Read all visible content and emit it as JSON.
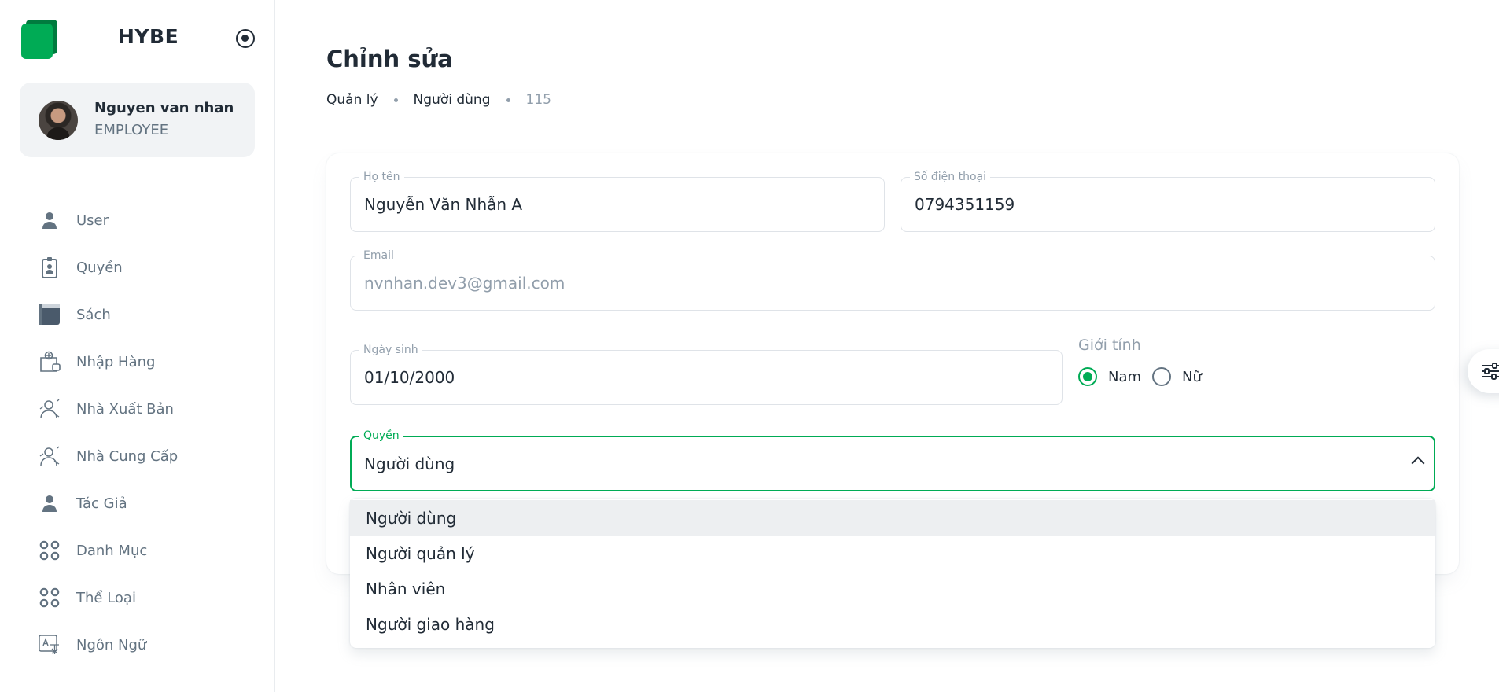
{
  "brand": {
    "name": "HYBE"
  },
  "account": {
    "name": "Nguyen van nhan",
    "role": "EMPLOYEE"
  },
  "sidebar": {
    "items": [
      {
        "label": "User",
        "icon": "person-icon"
      },
      {
        "label": "Quyền",
        "icon": "id-badge-icon"
      },
      {
        "label": "Sách",
        "icon": "book-icon"
      },
      {
        "label": "Nhập Hàng",
        "icon": "import-bag-icon"
      },
      {
        "label": "Nhà Xuất Bản",
        "icon": "publisher-icon"
      },
      {
        "label": "Nhà Cung Cấp",
        "icon": "supplier-icon"
      },
      {
        "label": "Tác Giả",
        "icon": "person-icon"
      },
      {
        "label": "Danh Mục",
        "icon": "grid-circles-icon"
      },
      {
        "label": "Thể Loại",
        "icon": "grid-circles-icon"
      },
      {
        "label": "Ngôn Ngữ",
        "icon": "translate-icon"
      }
    ]
  },
  "page": {
    "title": "Chỉnh sửa",
    "breadcrumb": [
      "Quản lý",
      "Người dùng",
      "115"
    ]
  },
  "form": {
    "fullname": {
      "label": "Họ tên",
      "value": "Nguyễn Văn Nhẫn A"
    },
    "phone": {
      "label": "Số điện thoại",
      "value": "0794351159"
    },
    "email": {
      "label": "Email",
      "value": "nvnhan.dev3@gmail.com"
    },
    "birthday": {
      "label": "Ngày sinh",
      "value": "01/10/2000"
    },
    "gender": {
      "label": "Giới tính",
      "options": [
        "Nam",
        "Nữ"
      ],
      "selected": "Nam"
    },
    "role": {
      "label": "Quyền",
      "value": "Người dùng",
      "options": [
        "Người dùng",
        "Người quản lý",
        "Nhân viên",
        "Người giao hàng"
      ]
    }
  },
  "colors": {
    "primary": "#00ab55",
    "text": "#212b36",
    "muted": "#637381",
    "placeholder": "#919eab"
  }
}
